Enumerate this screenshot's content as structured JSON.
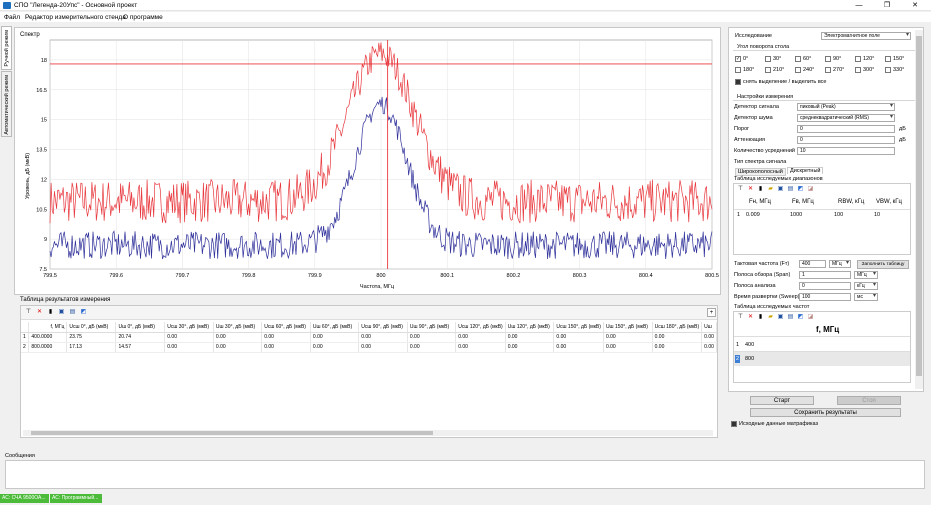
{
  "window": {
    "title": "СПО \"Легенда-20Упс\" - Основной проект",
    "min": "—",
    "max": "❐",
    "close": "✕"
  },
  "menu": [
    "Файл",
    "Редактор измерительного стенда",
    "О программе"
  ],
  "side_tabs": [
    "Ручной режим",
    "Автоматический режим"
  ],
  "chart_data": {
    "type": "line",
    "title": "Спектр",
    "xlabel": "Частота, МГц",
    "ylabel": "Уровень, дБ (мкВ)",
    "xlim": [
      799.5,
      800.5
    ],
    "ylim": [
      7.5,
      19
    ],
    "xticks": [
      "799.5",
      "799.6",
      "799.7",
      "799.8",
      "799.9",
      "800",
      "800.1",
      "800.2",
      "800.3",
      "800.4",
      "800.5"
    ],
    "yticks": [
      "18",
      "16.5",
      "15",
      "13.5",
      "12",
      "10.5",
      "9",
      "7.5"
    ],
    "threshold": 17.8,
    "marker_x": 800.01,
    "series": [
      {
        "color": "#e8383d",
        "baseline": 10.9,
        "noise": 1.1,
        "peak": 18.3,
        "peak_x": 800.0,
        "width": 0.07
      },
      {
        "color": "#2e2f9a",
        "baseline": 8.7,
        "noise": 0.7,
        "peak": 15.8,
        "peak_x": 800.0,
        "width": 0.055
      }
    ]
  },
  "results": {
    "title": "Таблица результатов измерения",
    "headers": [
      "f, МГц",
      "Uсш 0°, дБ (мкВ)",
      "Uш 0°, дБ (мкВ)",
      "Uсш 30°, дБ (мкВ)",
      "Uш 30°, дБ (мкВ)",
      "Uсш 60°, дБ (мкВ)",
      "Uш 60°, дБ (мкВ)",
      "Uсш 90°, дБ (мкВ)",
      "Uш 90°, дБ (мкВ)",
      "Uсш 120°, дБ (мкВ)",
      "Uш 120°, дБ (мкВ)",
      "Uсш 150°, дБ (мкВ)",
      "Uш 150°, дБ (мкВ)",
      "Uсш 180°, дБ (мкВ)",
      "Uш"
    ],
    "rows": [
      [
        "1",
        "400.0000",
        "23.75",
        "20.74",
        "0.00",
        "0.00",
        "0.00",
        "0.00",
        "0.00",
        "0.00",
        "0.00",
        "0.00",
        "0.00",
        "0.00",
        "0.00",
        "0.00"
      ],
      [
        "2",
        "800.0000",
        "17.13",
        "14.57",
        "0.00",
        "0.00",
        "0.00",
        "0.00",
        "0.00",
        "0.00",
        "0.00",
        "0.00",
        "0.00",
        "0.00",
        "0.00",
        "0.00"
      ]
    ]
  },
  "settings": {
    "research_label": "Исследование",
    "research_value": "Электромагнитное поле",
    "angle_group": "Угол поворота стола",
    "angles": [
      "0°",
      "30°",
      "60°",
      "90°",
      "120°",
      "150°",
      "180°",
      "210°",
      "240°",
      "270°",
      "300°",
      "330°"
    ],
    "select_label": "снять выделение / выделить все",
    "measure_group": "Настройки измерения",
    "detector_signal_label": "Детектор сигнала",
    "detector_signal_value": "пиковый (Peak)",
    "detector_noise_label": "Детектор шума",
    "detector_noise_value": "среднеквадратический (RMS)",
    "threshold_label": "Порог",
    "threshold_value": "0",
    "threshold_unit": "дБ",
    "atten_label": "Аттенюация",
    "atten_value": "0",
    "atten_unit": "дБ",
    "avg_label": "Количество усреднений",
    "avg_value": "10",
    "spectrum_type_label": "Тип спектра сигнала",
    "tab1": "Широкополосный",
    "tab2": "Дискретный",
    "ranges_title": "Таблица исследуемых диапазонов",
    "ranges_headers": [
      "Fн, МГц",
      "Fв, МГц",
      "RBW, кГц",
      "VBW, кГц"
    ],
    "ranges_row": [
      "1",
      "0.009",
      "1000",
      "100",
      "10"
    ],
    "clock_label": "Тактовая частота (Fт)",
    "clock_value": "400",
    "clock_unit": "МГц",
    "fill_button": "Заполнить таблицу",
    "span_label": "Полоса обзора (Span)",
    "span_value": "1",
    "span_unit": "МГц",
    "bw_label": "Полоса анализа",
    "bw_value": "0",
    "bw_unit": "кГц",
    "sweep_label": "Время развертки (Sweep)",
    "sweep_value": "100",
    "sweep_unit": "мс",
    "freq_title": "Таблица исследуемых частот",
    "freq_header": "f, МГц",
    "freq_rows": [
      [
        "1",
        "400"
      ],
      [
        "2",
        "800"
      ]
    ]
  },
  "actions": {
    "start": "Старт",
    "stop": "Стоп",
    "save": "Сохранить результаты",
    "source_data": "Исходные данные матрафиказ"
  },
  "messages": {
    "title": "Сообщения"
  },
  "status": {
    "item1": "АС: СЧА 9500ОА...",
    "item2": "АС: Программный..."
  }
}
